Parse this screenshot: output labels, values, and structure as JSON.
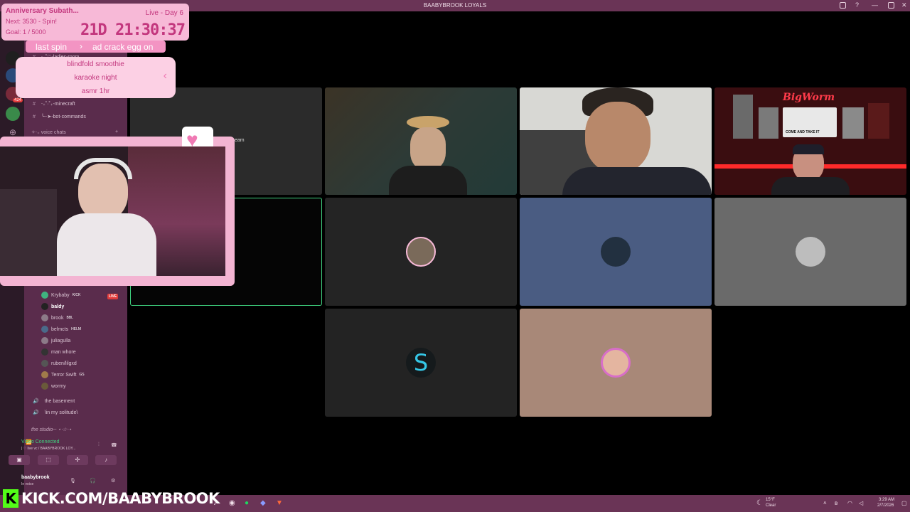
{
  "window": {
    "title": "BAABYBROOK LOYALS"
  },
  "overlay": {
    "event_title": "Anniversary Subath...",
    "day_label": "Live - Day 6",
    "next": "Next: 3530 - Spin!",
    "goal": "Goal: 1 / 5000",
    "timer": "21D  21:30:37",
    "last_spin_label": "last spin",
    "last_spin_value": "ad crack egg on",
    "spin_items": [
      "blindfold smoothie",
      "karaoke night",
      "asmr 1hr"
    ]
  },
  "sidebar": {
    "channels_top": [
      {
        "name": "‧₊˚♡-ladies-room"
      },
      {
        "name": "‧₊˚·˚₊-minecraft"
      },
      {
        "name": "╰┈➤-bot-commands"
      }
    ],
    "voice_header": "✧‧₊ voice chats",
    "members": [
      {
        "name": "Krybaby",
        "tag": "KICK",
        "live": "LIVE"
      },
      {
        "name": "baldy",
        "tag": ""
      },
      {
        "name": "brook",
        "tag": "BBL"
      },
      {
        "name": "belmcts",
        "tag": "HELM"
      },
      {
        "name": "juliagulla",
        "tag": ""
      },
      {
        "name": "man whore",
        "tag": ""
      },
      {
        "name": "ruben/lilgxd",
        "tag": ""
      },
      {
        "name": "Terror Swift",
        "tag": "GS"
      },
      {
        "name": "wormy",
        "tag": ""
      }
    ],
    "voice_channels": [
      "the basement",
      "\\in my solitude\\"
    ],
    "studio_header": "the studio─ ⋆⋅☆⋅⋆",
    "video_status": "Video Connected",
    "video_sub": "| ♡ live vc / BAABYBROOK LOY...",
    "user_name": "baabybrook",
    "user_status": "In voice"
  },
  "taskbar": {
    "kick_text": "KICK.COM/BAABYBROOK",
    "weather_temp": "15°F",
    "weather_cond": "Clear",
    "time": "3:29 AM",
    "date": "2/7/2026"
  },
  "tiles": {
    "stream_label": "eam",
    "bigworm_sign": "BigWorm",
    "bigworm_banner": "COME AND TAKE IT"
  },
  "colors": {
    "accent_pink": "#f7b9d7",
    "sidebar": "#5a2c4c",
    "live_red": "#e23b3b",
    "kick_green": "#53fc18"
  }
}
